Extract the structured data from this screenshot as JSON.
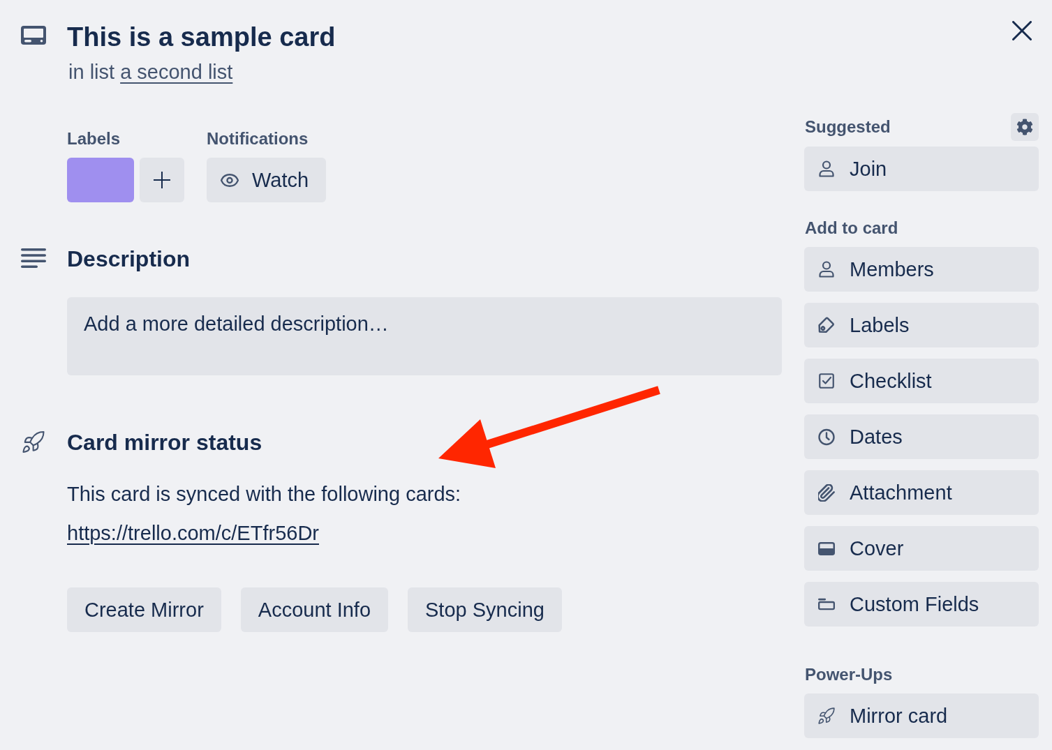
{
  "card": {
    "title": "This is a sample card",
    "list_prefix": "in list",
    "list_name": "a second list"
  },
  "labels": {
    "heading": "Labels",
    "items": [
      {
        "color": "#9f8fef"
      }
    ]
  },
  "notifications": {
    "heading": "Notifications",
    "button": "Watch"
  },
  "description": {
    "heading": "Description",
    "placeholder": "Add a more detailed description…"
  },
  "mirror_status": {
    "heading": "Card mirror status",
    "text": "This card is synced with the following cards:",
    "links": [
      "https://trello.com/c/ETfr56Dr"
    ],
    "buttons": [
      "Create Mirror",
      "Account Info",
      "Stop Syncing"
    ]
  },
  "sidebar": {
    "sections": [
      {
        "heading": "Suggested",
        "settings": true,
        "items": [
          {
            "kind": "join",
            "label": "Join"
          }
        ]
      },
      {
        "heading": "Add to card",
        "items": [
          {
            "kind": "members",
            "label": "Members"
          },
          {
            "kind": "labels",
            "label": "Labels"
          },
          {
            "kind": "checklist",
            "label": "Checklist"
          },
          {
            "kind": "dates",
            "label": "Dates"
          },
          {
            "kind": "attachment",
            "label": "Attachment"
          },
          {
            "kind": "cover",
            "label": "Cover"
          },
          {
            "kind": "fields",
            "label": "Custom Fields"
          }
        ]
      },
      {
        "heading": "Power-Ups",
        "items": [
          {
            "kind": "mirror",
            "label": "Mirror card"
          }
        ]
      }
    ]
  }
}
